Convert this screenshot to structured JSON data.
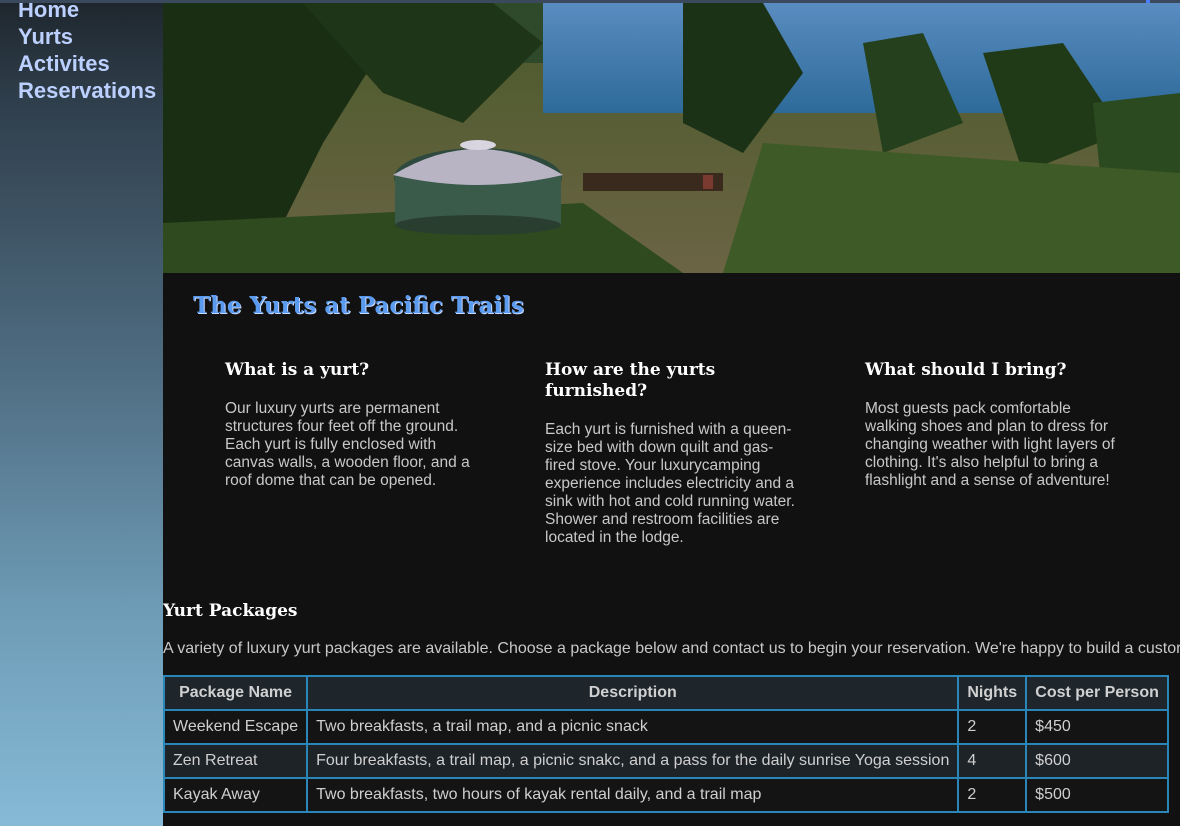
{
  "nav": {
    "items": [
      {
        "label": "Home"
      },
      {
        "label": "Yurts"
      },
      {
        "label": "Activites"
      },
      {
        "label": "Reservations"
      }
    ]
  },
  "hero": {
    "image": "yurt-among-trees-ocean-photo"
  },
  "page_title": "The Yurts at Pacific Trails",
  "columns": [
    {
      "heading": "What is a yurt?",
      "text": "Our luxury yurts are permanent structures four feet off the ground. Each yurt is fully enclosed with canvas walls, a wooden floor, and a roof dome that can be opened."
    },
    {
      "heading": "How are the yurts furnished?",
      "text": "Each yurt is furnished with a queen-size bed with down quilt and gas-fired stove. Your luxurycamping experience includes electricity and a sink with hot and cold running water. Shower and restroom facilities are located in the lodge."
    },
    {
      "heading": "What should I bring?",
      "text": "Most guests pack comfortable walking shoes and plan to dress for changing weather with light layers of clothing. It's also helpful to bring a flashlight and a sense of adventure!"
    }
  ],
  "packages": {
    "title": "Yurt Packages",
    "intro": "A variety of luxury yurt packages are available. Choose a package below and contact us to begin your reservation. We're happy to build a custor",
    "headers": [
      "Package Name",
      "Description",
      "Nights",
      "Cost per Person"
    ],
    "rows": [
      [
        "Weekend Escape",
        "Two breakfasts, a trail map, and a picnic snack",
        "2",
        "$450"
      ],
      [
        "Zen Retreat",
        "Four breakfasts, a trail map, a picnic snakc, and a pass for the daily sunrise Yoga session",
        "4",
        "$600"
      ],
      [
        "Kayak Away",
        "Two breakfasts, two hours of kayak rental daily, and a trail map",
        "2",
        "$500"
      ]
    ]
  },
  "colors": {
    "title_blue": "#5a9bef",
    "nav_link": "#bcd0ff",
    "table_border": "#2a86b8",
    "background": "#111111"
  }
}
